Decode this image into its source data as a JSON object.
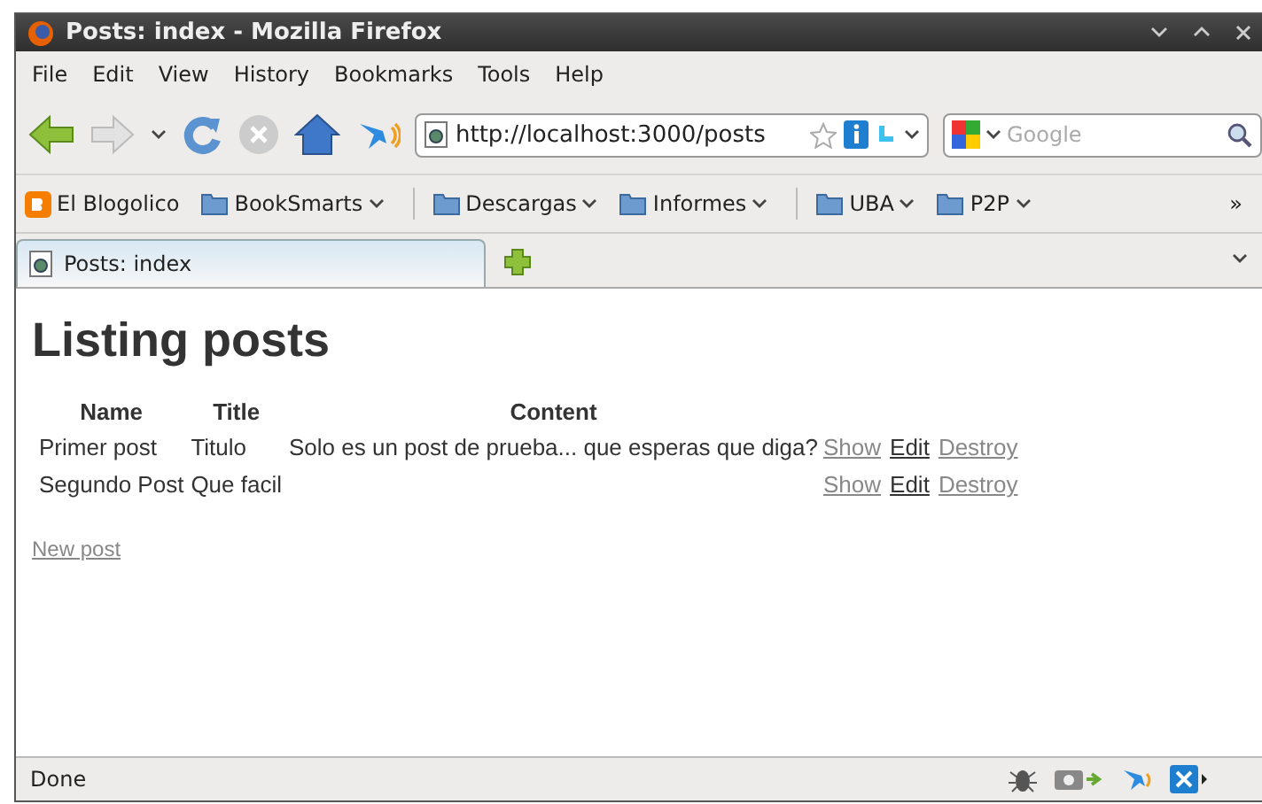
{
  "window": {
    "title": "Posts: index - Mozilla Firefox"
  },
  "menu": [
    "File",
    "Edit",
    "View",
    "History",
    "Bookmarks",
    "Tools",
    "Help"
  ],
  "address": {
    "value": "http://localhost:3000/posts"
  },
  "search": {
    "placeholder": "Google"
  },
  "bookmarks": [
    {
      "label": "El Blogolico",
      "kind": "blog",
      "dropdown": false
    },
    {
      "label": "BookSmarts",
      "kind": "folder",
      "dropdown": true
    },
    {
      "label": "Descargas",
      "kind": "folder",
      "dropdown": true
    },
    {
      "label": "Informes",
      "kind": "folder",
      "dropdown": true
    },
    {
      "label": "UBA",
      "kind": "folder",
      "dropdown": true
    },
    {
      "label": "P2P",
      "kind": "folder",
      "dropdown": true
    }
  ],
  "bookmarks_overflow": "»",
  "tabs": [
    {
      "label": "Posts: index",
      "selected": true
    }
  ],
  "page": {
    "heading": "Listing posts",
    "table": {
      "columns": [
        "Name",
        "Title",
        "Content"
      ],
      "rows": [
        {
          "cells": [
            "Primer post",
            "Titulo",
            "Solo es un post de prueba... que esperas que diga?"
          ],
          "links": [
            {
              "label": "Show",
              "visited": true
            },
            {
              "label": "Edit",
              "visited": false
            },
            {
              "label": "Destroy",
              "visited": true
            }
          ]
        },
        {
          "cells": [
            "Segundo Post",
            "Que facil",
            ""
          ],
          "links": [
            {
              "label": "Show",
              "visited": true
            },
            {
              "label": "Edit",
              "visited": false
            },
            {
              "label": "Destroy",
              "visited": true
            }
          ]
        }
      ]
    },
    "new_link": {
      "label": "New post",
      "visited": true
    }
  },
  "status_bar": {
    "text": "Done"
  }
}
